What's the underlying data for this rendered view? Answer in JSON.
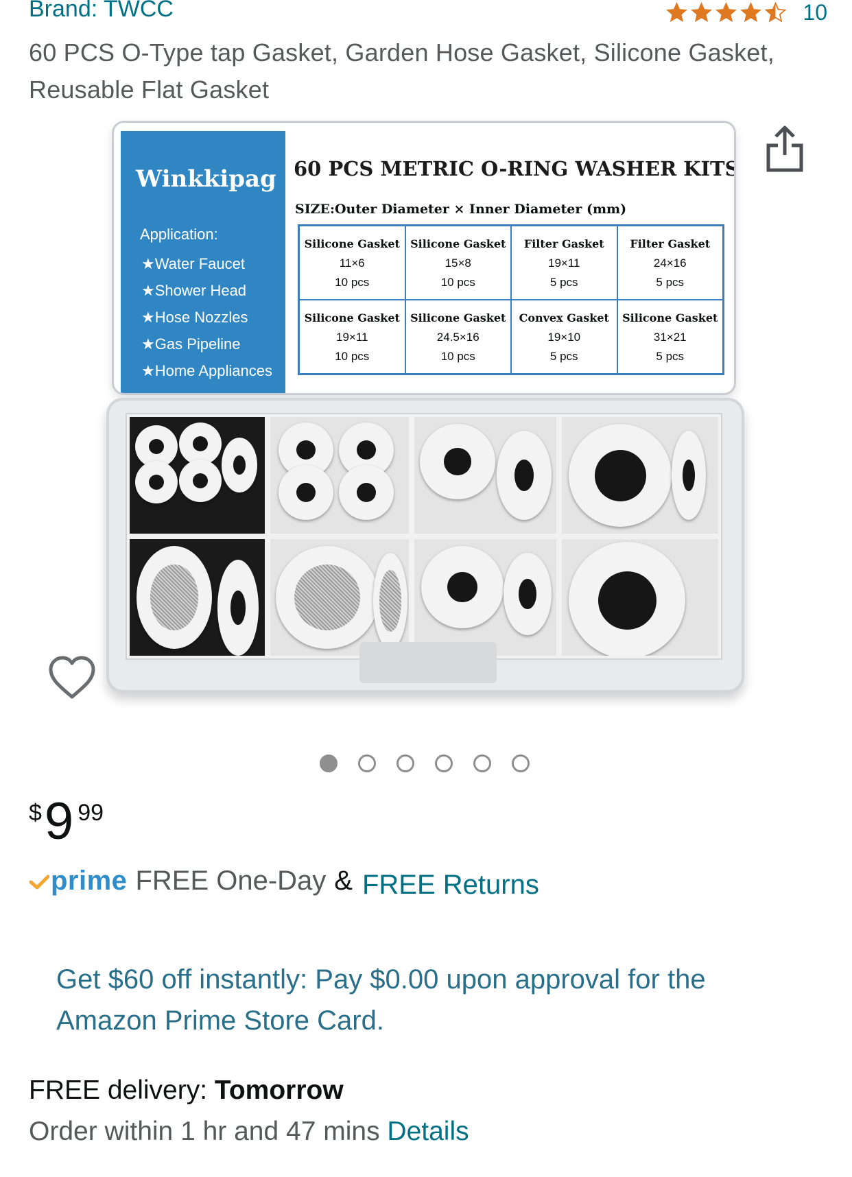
{
  "brand": "Brand: TWCC",
  "rating": {
    "stars": 4.5,
    "count": "10",
    "star_color": "#de7921"
  },
  "title": "60 PCS O-Type tap Gasket, Garden Hose Gasket, Silicone Gasket, Reusable Flat Gasket",
  "product_image": {
    "brand": "Winkkipag",
    "heading": "60 PCS METRIC O-RING WASHER KITS",
    "size_note": "SIZE:Outer Diameter × Inner Diameter (mm)",
    "application_title": "Application:",
    "applications": [
      "Water Faucet",
      "Shower Head",
      "Hose Nozzles",
      "Gas Pipeline",
      "Home Appliances"
    ],
    "sizes": [
      {
        "type": "Silicone Gasket",
        "size": "11×6",
        "qty": "10 pcs"
      },
      {
        "type": "Silicone Gasket",
        "size": "15×8",
        "qty": "10 pcs"
      },
      {
        "type": "Filter Gasket",
        "size": "19×11",
        "qty": "5 pcs"
      },
      {
        "type": "Filter Gasket",
        "size": "24×16",
        "qty": "5 pcs"
      },
      {
        "type": "Silicone Gasket",
        "size": "19×11",
        "qty": "10 pcs"
      },
      {
        "type": "Silicone Gasket",
        "size": "24.5×16",
        "qty": "10 pcs"
      },
      {
        "type": "Convex Gasket",
        "size": "19×10",
        "qty": "5 pcs"
      },
      {
        "type": "Silicone Gasket",
        "size": "31×21",
        "qty": "5 pcs"
      }
    ],
    "accent_color": "#2f86c3"
  },
  "carousel": {
    "total": 6,
    "active": 1
  },
  "price": {
    "currency": "$",
    "whole": "9",
    "fraction": "99"
  },
  "prime": {
    "logo": "prime",
    "shipping": "FREE One-Day",
    "amp": "&",
    "returns": "FREE Returns",
    "color": "#2f8ec9"
  },
  "promo": "Get $60 off instantly: Pay $0.00 upon approval for the Amazon Prime Store Card.",
  "delivery": {
    "label": "FREE delivery:",
    "date": "Tomorrow",
    "order_within": "Order within 1 hr and 47 mins",
    "details": "Details"
  },
  "icons": {
    "share": "share-icon",
    "wishlist": "heart-icon"
  }
}
